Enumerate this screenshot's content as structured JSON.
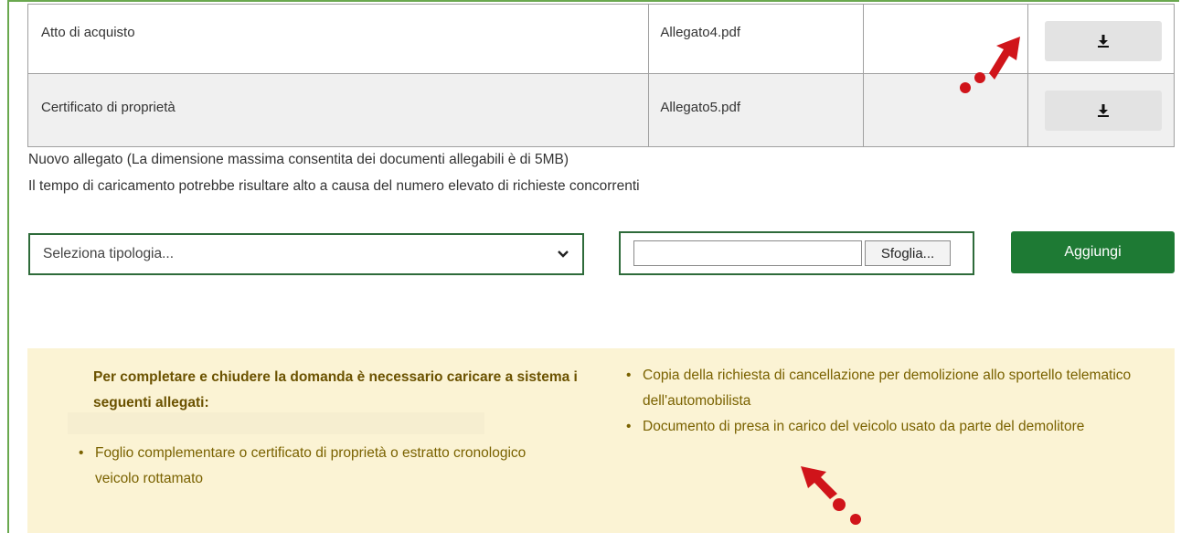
{
  "attachments": {
    "rows": [
      {
        "name": "Atto di acquisto",
        "file": "Allegato4.pdf",
        "download_icon": "download-icon"
      },
      {
        "name": "Certificato di proprietà",
        "file": "Allegato5.pdf",
        "download_icon": "download-icon"
      }
    ]
  },
  "info": {
    "line1": "Nuovo allegato (La dimensione massima consentita dei documenti allegabili è di 5MB)",
    "line2": "Il tempo di caricamento potrebbe risultare alto a causa del numero elevato di richieste concorrenti"
  },
  "form": {
    "select_value": "Seleziona tipologia...",
    "browse_label": "Sfoglia...",
    "add_label": "Aggiungi"
  },
  "notice": {
    "title": "Per completare e chiudere la domanda è necessario caricare a sistema i seguenti allegati:",
    "items_left": [
      "Foglio complementare o certificato di proprietà o estratto cronologico veicolo rottamato"
    ],
    "items_right": [
      "Copia della richiesta di cancellazione per demolizione allo sportello telematico dell'automobilista",
      "Documento di presa in carico del veicolo usato da parte del demolitore"
    ]
  },
  "colors": {
    "accent_green": "#1e7a34",
    "frame_green": "#6aa84f",
    "notice_bg": "#fbf3d4",
    "notice_text": "#6b5200",
    "annotation_red": "#d0141a"
  }
}
